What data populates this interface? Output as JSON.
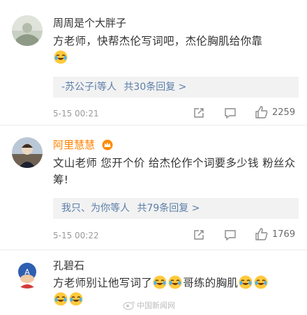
{
  "comments": [
    {
      "username": "周周是个大胖子",
      "text": "方老师，快帮杰伦写词吧，杰伦胸肌给你靠",
      "text_emojis": [
        "laughing-tears-emoji"
      ],
      "reply_link": "-苏公子i等人",
      "reply_count": "共30条回复 >",
      "timestamp": "5-15 00:21",
      "likes": "2259"
    },
    {
      "username": "阿里慧慧",
      "username_badge": "vip-crown-icon",
      "text": "文山老师 您开个价 给杰伦作个词要多少钱 粉丝众筹!",
      "reply_link": "我只、为你等人",
      "reply_count": "共79条回复 >",
      "timestamp": "5-15 00:22",
      "likes": "1769"
    },
    {
      "username": "孔碧石",
      "text_part1": "方老师别让他写词了",
      "text_part2": "哥练的胸肌"
    }
  ],
  "watermark": "中国新闻网",
  "icons": {
    "repost": "repost-icon",
    "comment": "comment-icon",
    "like": "like-icon"
  },
  "colors": {
    "link": "#5b7ea8",
    "vip_name": "#ff8200",
    "reply_bg": "#f2f2f2"
  }
}
